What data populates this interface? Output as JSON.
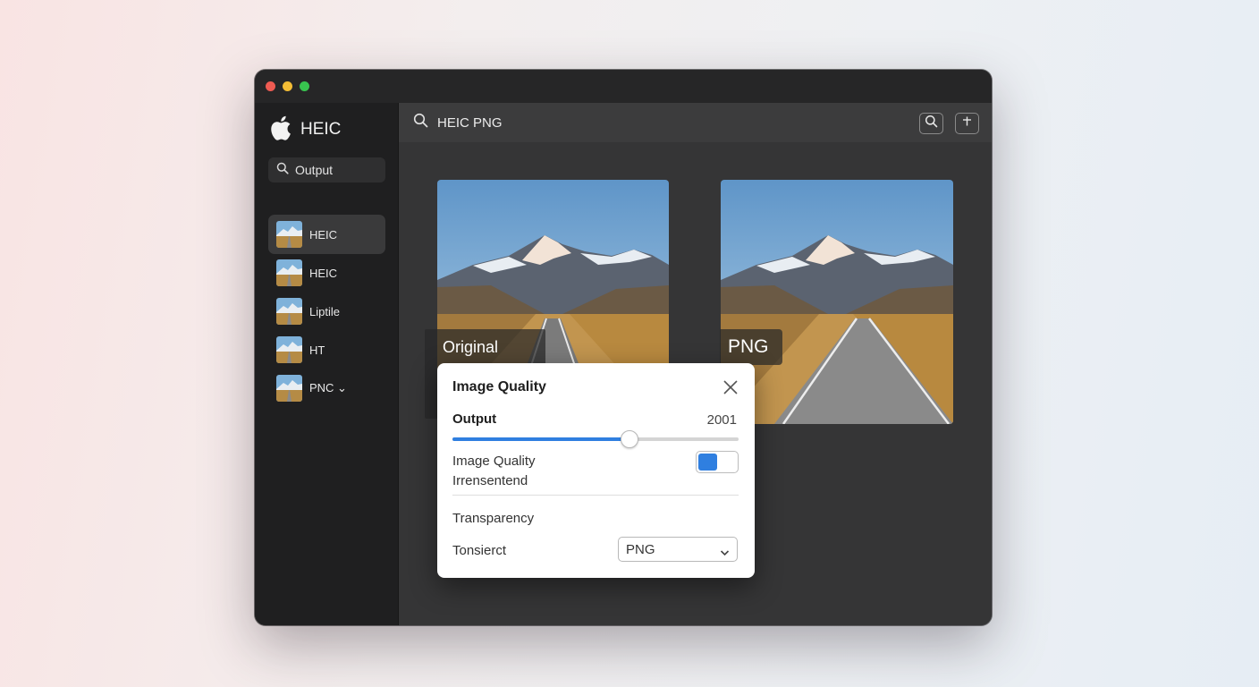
{
  "window": {
    "traffic_lights": {
      "close": "#ee5b52",
      "minimize": "#f3bc35",
      "zoom": "#38c44f"
    }
  },
  "sidebar": {
    "brand_icon": "apple-logo-icon",
    "brand_title": "HEIC",
    "search": {
      "icon": "search-icon",
      "value": "Output"
    },
    "items": [
      {
        "label": "HEIC",
        "active": true
      },
      {
        "label": "HEIC",
        "active": false
      },
      {
        "label": "Liptile",
        "active": false
      },
      {
        "label": "HT",
        "active": false
      },
      {
        "label": "PNC ⌄",
        "active": false
      }
    ]
  },
  "toolbar": {
    "search_icon": "search-icon",
    "query": "HEIC PNG",
    "buttons": [
      "search-icon",
      "add-icon"
    ]
  },
  "previews": {
    "left_label": "Original",
    "right_label": "PNG"
  },
  "dialog": {
    "title": "Image Quality",
    "close_icon": "close-icon",
    "output_label": "Output",
    "output_value": "2001",
    "slider_fraction": 0.62,
    "accent": "#2f7fe0",
    "image_quality_line1": "Image Quality",
    "image_quality_line2": "Irrensentend",
    "toggle_on": true,
    "transparency_label": "Transparency",
    "format_label": "Tonsierct",
    "format_value": "PNG",
    "dropdown_icon": "chevron-down-icon"
  }
}
